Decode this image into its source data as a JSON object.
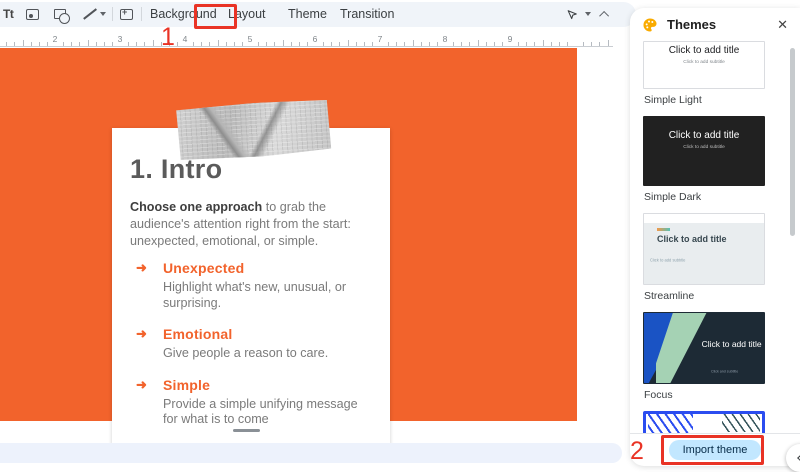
{
  "toolbar": {
    "textbox_glyph": "Tt",
    "buttons": {
      "background": "Background",
      "layout": "Layout",
      "theme": "Theme",
      "transition": "Transition"
    }
  },
  "ruler": {
    "numbers": [
      "2",
      "3",
      "4",
      "5",
      "6",
      "7",
      "8",
      "9"
    ]
  },
  "slide": {
    "title": "1. Intro",
    "intro_bold": "Choose one approach",
    "intro_rest": " to grab the audience's attention right from the start: unexpected, emotional, or simple.",
    "bullet_glyph": "➜",
    "bullets": [
      {
        "heading": "Unexpected",
        "body": "Highlight what's new, unusual, or surprising."
      },
      {
        "heading": "Emotional",
        "body": "Give people a reason to care."
      },
      {
        "heading": "Simple",
        "body": "Provide a simple unifying message for what is to come"
      }
    ]
  },
  "themes_panel": {
    "title": "Themes",
    "close_glyph": "✕",
    "items": [
      {
        "label": "Simple Light",
        "style": "light",
        "title": "Click to add title",
        "subtitle": "Click to add subtitle"
      },
      {
        "label": "Simple Dark",
        "style": "dark",
        "title": "Click to add title",
        "subtitle": "Click to add subtitle"
      },
      {
        "label": "Streamline",
        "style": "streamline",
        "title": "Click to add title",
        "subtitle": "Click to add subtitle"
      },
      {
        "label": "Focus",
        "style": "focus",
        "title": "Click to add title",
        "subtitle": "Click and subtitle"
      },
      {
        "label": "",
        "style": "shift",
        "title": "",
        "subtitle": ""
      }
    ],
    "import_button_label": "Import theme"
  },
  "annotations": {
    "step1": "1",
    "step2": "2"
  },
  "colors": {
    "slide_orange": "#F2632C",
    "annotation_red": "#E93325",
    "import_button_bg": "#C2E7FF",
    "focus_blue": "#1A53C4",
    "focus_mint": "#A5D2B4",
    "shift_border_blue": "#2B4DF0"
  }
}
